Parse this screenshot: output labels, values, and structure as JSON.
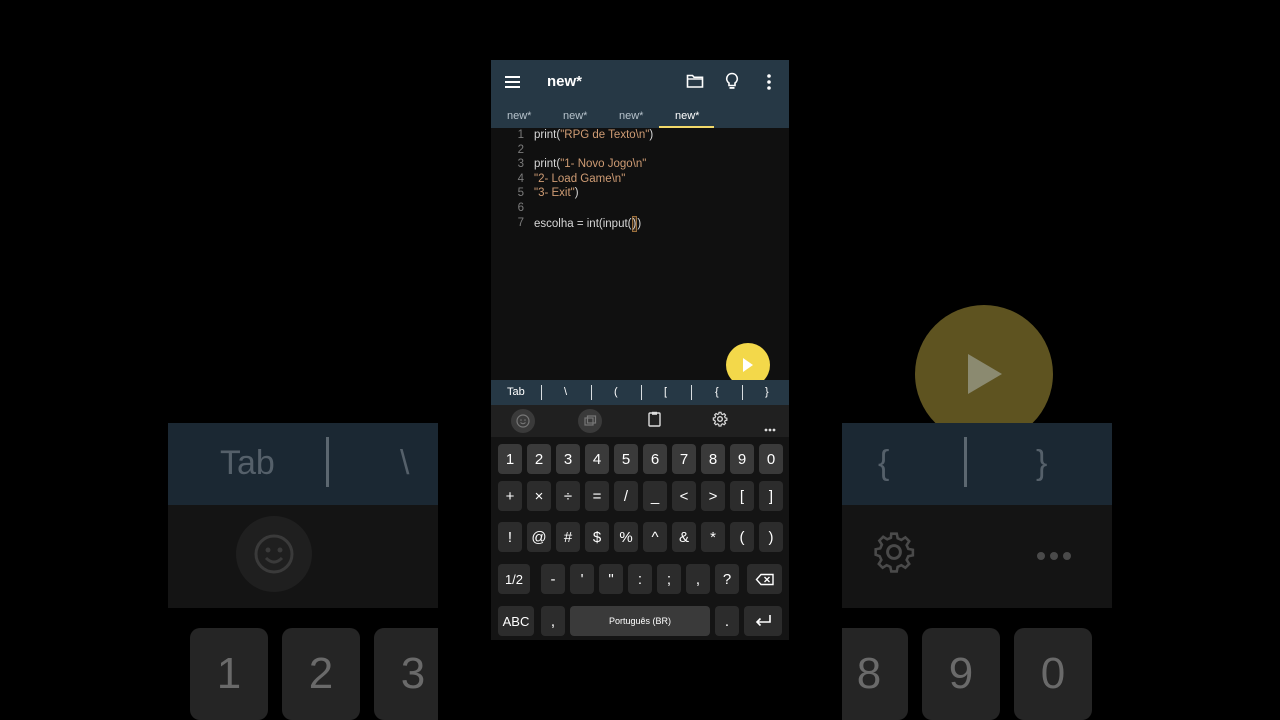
{
  "app": {
    "title": "new*",
    "tabs": [
      "new*",
      "new*",
      "new*",
      "new*"
    ],
    "active_tab": 3,
    "accent": "#f3d84a",
    "toolbar_color": "#263845"
  },
  "icons": {
    "menu": "menu-icon",
    "folder": "folder-icon",
    "lightbulb": "lightbulb-icon",
    "more": "more-vert-icon",
    "run": "play-icon"
  },
  "editor": {
    "lines": [
      {
        "num": "1",
        "code": "print(\"RPG de Texto\\n\")"
      },
      {
        "num": "2",
        "code": ""
      },
      {
        "num": "3",
        "code": "print(\"1- Novo Jogo\\n\""
      },
      {
        "num": "4",
        "code": "\"2- Load Game\\n\""
      },
      {
        "num": "5",
        "code": "\"3- Exit\")"
      },
      {
        "num": "6",
        "code": ""
      },
      {
        "num": "7",
        "code": "escolha = int(input())"
      }
    ]
  },
  "symbol_bar": [
    "Tab",
    "\\",
    "(",
    "[",
    "{",
    "}"
  ],
  "keyboard": {
    "row1": [
      "1",
      "2",
      "3",
      "4",
      "5",
      "6",
      "7",
      "8",
      "9",
      "0"
    ],
    "row2": [
      "+",
      "×",
      "÷",
      "=",
      "/",
      "_",
      "<",
      ">",
      "[",
      "]"
    ],
    "row3": [
      "!",
      "@",
      "#",
      "$",
      "%",
      "^",
      "&",
      "*",
      "(",
      ")"
    ],
    "row4": [
      "1/2",
      "-",
      "'",
      "\"",
      ":",
      ";",
      ",",
      "?"
    ],
    "abc": "ABC",
    "comma": ",",
    "space": "Português (BR)",
    "period": "."
  },
  "background_zoom": {
    "left": {
      "tab": "Tab",
      "backslash": "\\",
      "keys": [
        "1",
        "2",
        "3"
      ]
    },
    "right": {
      "brace_open": "{",
      "brace_close": "}",
      "keys": [
        "8",
        "9",
        "0"
      ]
    }
  }
}
